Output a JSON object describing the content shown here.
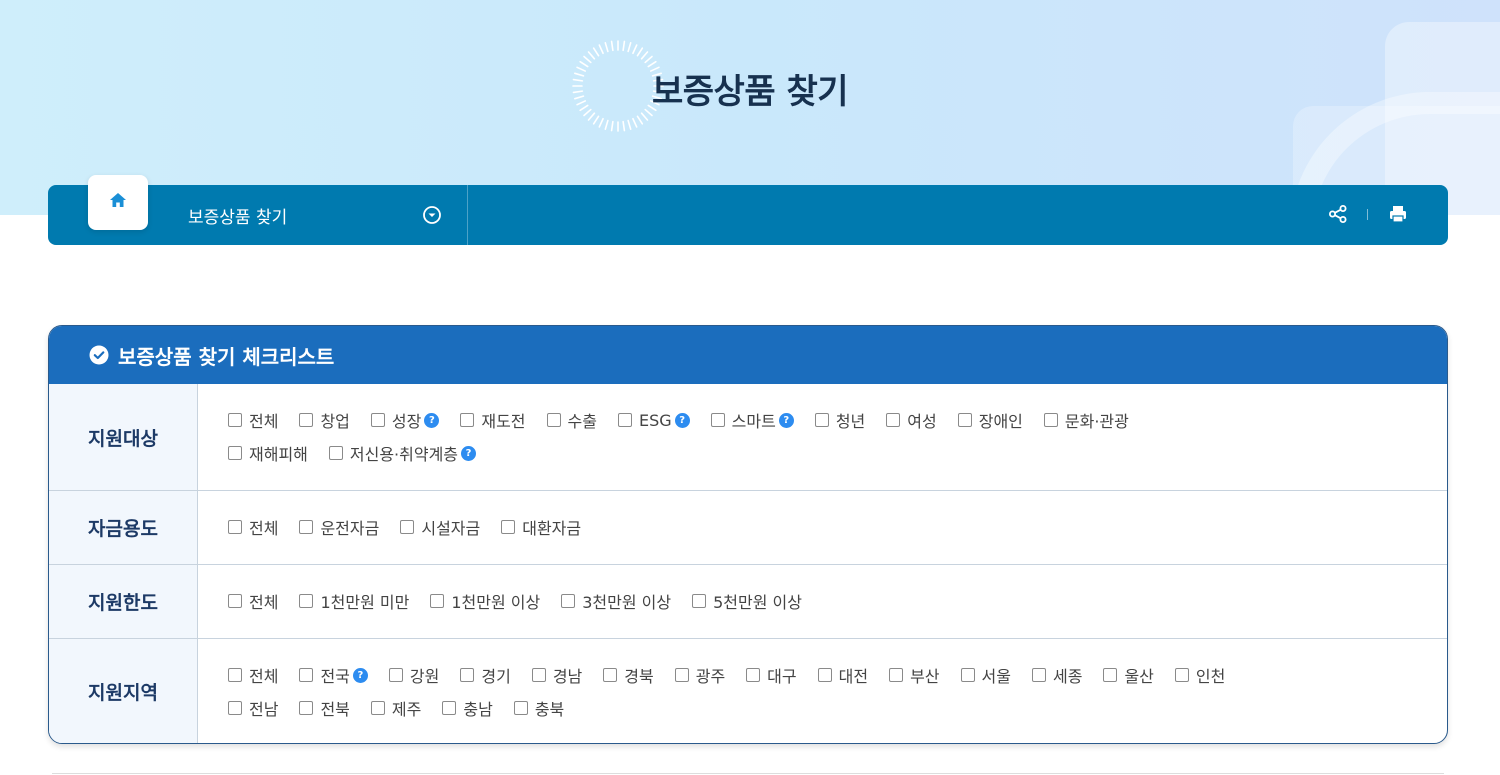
{
  "page": {
    "title": "보증상품 찾기"
  },
  "navbar": {
    "menu_label": "보증상품 찾기",
    "icons": {
      "home": "home-icon",
      "dropdown": "chevron-down-circle-icon",
      "share": "share-icon",
      "print": "print-icon"
    }
  },
  "checklist": {
    "title": "보증상품 찾기 체크리스트",
    "rows": [
      {
        "label": "지원대상",
        "options": [
          {
            "label": "전체",
            "help": false
          },
          {
            "label": "창업",
            "help": false
          },
          {
            "label": "성장",
            "help": true
          },
          {
            "label": "재도전",
            "help": false
          },
          {
            "label": "수출",
            "help": false
          },
          {
            "label": "ESG",
            "help": true
          },
          {
            "label": "스마트",
            "help": true
          },
          {
            "label": "청년",
            "help": false
          },
          {
            "label": "여성",
            "help": false
          },
          {
            "label": "장애인",
            "help": false
          },
          {
            "label": "문화·관광",
            "help": false
          },
          {
            "label": "재해피해",
            "help": false
          },
          {
            "label": "저신용·취약계층",
            "help": true
          }
        ]
      },
      {
        "label": "자금용도",
        "options": [
          {
            "label": "전체",
            "help": false
          },
          {
            "label": "운전자금",
            "help": false
          },
          {
            "label": "시설자금",
            "help": false
          },
          {
            "label": "대환자금",
            "help": false
          }
        ]
      },
      {
        "label": "지원한도",
        "options": [
          {
            "label": "전체",
            "help": false
          },
          {
            "label": "1천만원 미만",
            "help": false
          },
          {
            "label": "1천만원 이상",
            "help": false
          },
          {
            "label": "3천만원 이상",
            "help": false
          },
          {
            "label": "5천만원 이상",
            "help": false
          }
        ]
      },
      {
        "label": "지원지역",
        "options": [
          {
            "label": "전체",
            "help": false
          },
          {
            "label": "전국",
            "help": true
          },
          {
            "label": "강원",
            "help": false
          },
          {
            "label": "경기",
            "help": false
          },
          {
            "label": "경남",
            "help": false
          },
          {
            "label": "경북",
            "help": false
          },
          {
            "label": "광주",
            "help": false
          },
          {
            "label": "대구",
            "help": false
          },
          {
            "label": "대전",
            "help": false
          },
          {
            "label": "부산",
            "help": false
          },
          {
            "label": "서울",
            "help": false
          },
          {
            "label": "세종",
            "help": false
          },
          {
            "label": "울산",
            "help": false
          },
          {
            "label": "인천",
            "help": false
          },
          {
            "label": "전남",
            "help": false
          },
          {
            "label": "전북",
            "help": false
          },
          {
            "label": "제주",
            "help": false
          },
          {
            "label": "충남",
            "help": false
          },
          {
            "label": "충북",
            "help": false
          }
        ]
      }
    ]
  },
  "help_glyph": "?",
  "colors": {
    "navbar": "#007aaf",
    "panel_header": "#1b6dbd",
    "label_text": "#1d3a66",
    "help_badge": "#2d8cf0"
  }
}
